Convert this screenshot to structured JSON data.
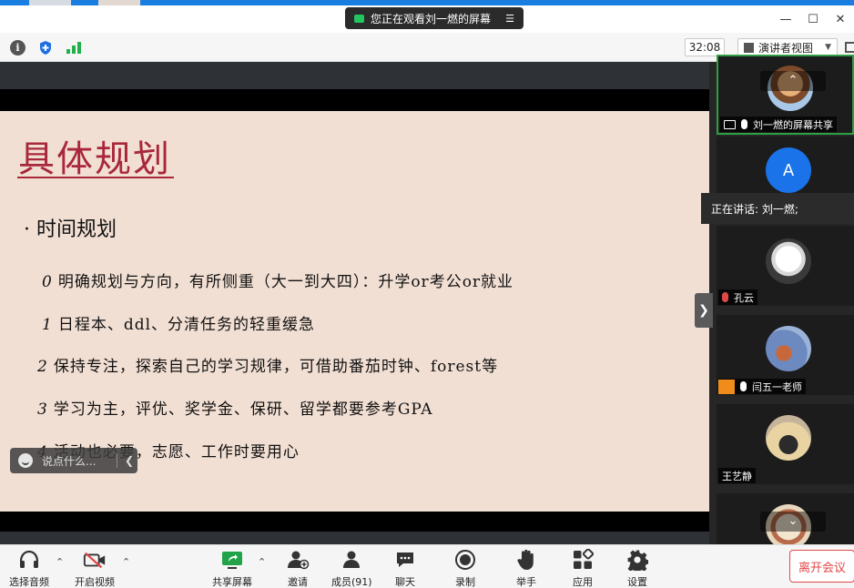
{
  "banner": {
    "text": "您正在观看刘一燃的屏幕"
  },
  "info": {
    "timer": "32:08",
    "view_label": "演讲者视图"
  },
  "slide": {
    "title": "具体规划",
    "bullet": "· 时间规划",
    "lines": [
      {
        "num": "0",
        "text": "明确规划与方向，有所侧重（大一到大四）：升学or考公or就业"
      },
      {
        "num": "1",
        "text": "日程本、ddl、分清任务的轻重缓急"
      },
      {
        "num": "2",
        "text": "保持专注，探索自己的学习规律，可借助番茄时钟、forest等"
      },
      {
        "num": "3",
        "text": "学习为主，评优、奖学金、保研、留学都要参考GPA"
      },
      {
        "num": "4",
        "text": "活动也必要，志愿、工作时要用心"
      }
    ]
  },
  "chat": {
    "placeholder": "说点什么..."
  },
  "participants": [
    {
      "label": "刘一燃的屏幕共享"
    },
    {
      "initial": "A"
    },
    {
      "label": "孔云"
    },
    {
      "label": "闫五一老师"
    },
    {
      "label": "王艺静"
    }
  ],
  "speaking": {
    "text": "正在讲话: 刘一燃;"
  },
  "toolbar": {
    "audio": "选择音频",
    "video": "开启视频",
    "share": "共享屏幕",
    "invite": "邀请",
    "members": "成员(91)",
    "chat": "聊天",
    "record": "录制",
    "raise_hand": "举手",
    "apps": "应用",
    "settings": "设置",
    "leave": "离开会议"
  }
}
